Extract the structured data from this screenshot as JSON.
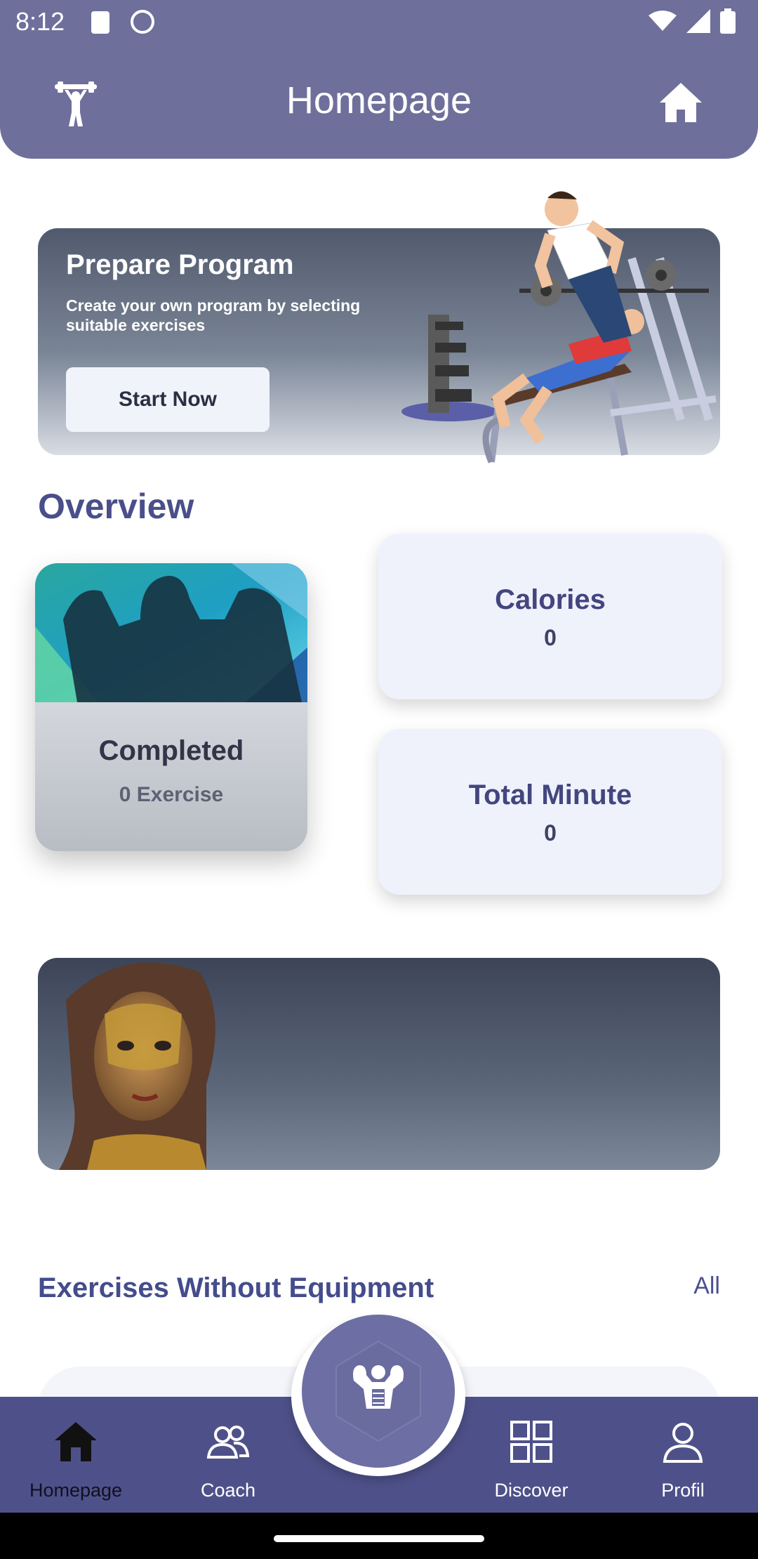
{
  "status_bar": {
    "time": "8:12"
  },
  "app_bar": {
    "title": "Homepage",
    "left_icon": "weightlifter-icon",
    "right_icon": "home-icon"
  },
  "hero": {
    "title": "Prepare Program",
    "subtitle": "Create your own program by selecting suitable exercises",
    "button_label": "Start Now"
  },
  "overview": {
    "heading": "Overview",
    "completed": {
      "label": "Completed",
      "value": "0 Exercise"
    },
    "calories": {
      "label": "Calories",
      "value": "0"
    },
    "total_minute": {
      "label": "Total Minute",
      "value": "0"
    }
  },
  "section": {
    "title": "Exercises Without Equipment",
    "all_label": "All"
  },
  "bottom_nav": {
    "items": [
      {
        "label": "Homepage",
        "icon": "home-icon",
        "active": true
      },
      {
        "label": "Coach",
        "icon": "people-icon",
        "active": false
      },
      {
        "label": "Discover",
        "icon": "grid-icon",
        "active": false
      },
      {
        "label": "Profil",
        "icon": "person-icon",
        "active": false
      }
    ],
    "center_icon": "muscle-icon"
  },
  "colors": {
    "primary": "#6f6f9c",
    "nav": "#4e5189",
    "accent_text": "#4a4f8a"
  }
}
